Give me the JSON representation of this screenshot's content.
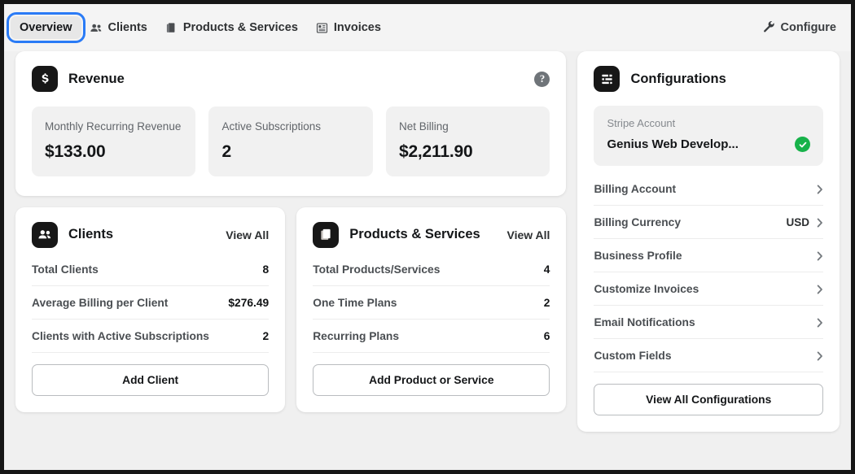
{
  "tabs": [
    {
      "label": "Overview",
      "icon": "none",
      "active": true
    },
    {
      "label": "Clients",
      "icon": "users-icon",
      "active": false
    },
    {
      "label": "Products & Services",
      "icon": "documents-icon",
      "active": false
    },
    {
      "label": "Invoices",
      "icon": "invoice-icon",
      "active": false
    }
  ],
  "configure": {
    "label": "Configure",
    "icon": "wrench-icon"
  },
  "revenue": {
    "title": "Revenue",
    "icon": "dollar-badge-icon",
    "help_icon": "help-circle-icon",
    "help_glyph": "?",
    "stats": [
      {
        "label": "Monthly Recurring Revenue",
        "value": "$133.00"
      },
      {
        "label": "Active Subscriptions",
        "value": "2"
      },
      {
        "label": "Net Billing",
        "value": "$2,211.90"
      }
    ]
  },
  "clients": {
    "title": "Clients",
    "icon": "users-badge-icon",
    "view_all": "View All",
    "rows": [
      {
        "label": "Total Clients",
        "value": "8"
      },
      {
        "label": "Average Billing per Client",
        "value": "$276.49"
      },
      {
        "label": "Clients with Active Subscriptions",
        "value": "2"
      }
    ],
    "button": "Add Client"
  },
  "products": {
    "title": "Products & Services",
    "icon": "documents-badge-icon",
    "view_all": "View All",
    "rows": [
      {
        "label": "Total Products/Services",
        "value": "4"
      },
      {
        "label": "One Time Plans",
        "value": "2"
      },
      {
        "label": "Recurring Plans",
        "value": "6"
      }
    ],
    "button": "Add Product or Service"
  },
  "configurations": {
    "title": "Configurations",
    "icon": "sliders-badge-icon",
    "stripe": {
      "label": "Stripe Account",
      "value": "Genius Web Develop...",
      "status_icon": "check-circle-icon",
      "status_color": "#17b24a"
    },
    "rows": [
      {
        "label": "Billing Account",
        "value": ""
      },
      {
        "label": "Billing Currency",
        "value": "USD"
      },
      {
        "label": "Business Profile",
        "value": ""
      },
      {
        "label": "Customize Invoices",
        "value": ""
      },
      {
        "label": "Email Notifications",
        "value": ""
      },
      {
        "label": "Custom Fields",
        "value": ""
      }
    ],
    "button": "View All Configurations"
  },
  "colors": {
    "accent": "#2a7bf6",
    "badge_dark": "#171717",
    "success": "#17b24a",
    "page_bg": "#f0f0f0",
    "card_bg": "#ffffff",
    "tile_bg": "#f1f1f1"
  }
}
